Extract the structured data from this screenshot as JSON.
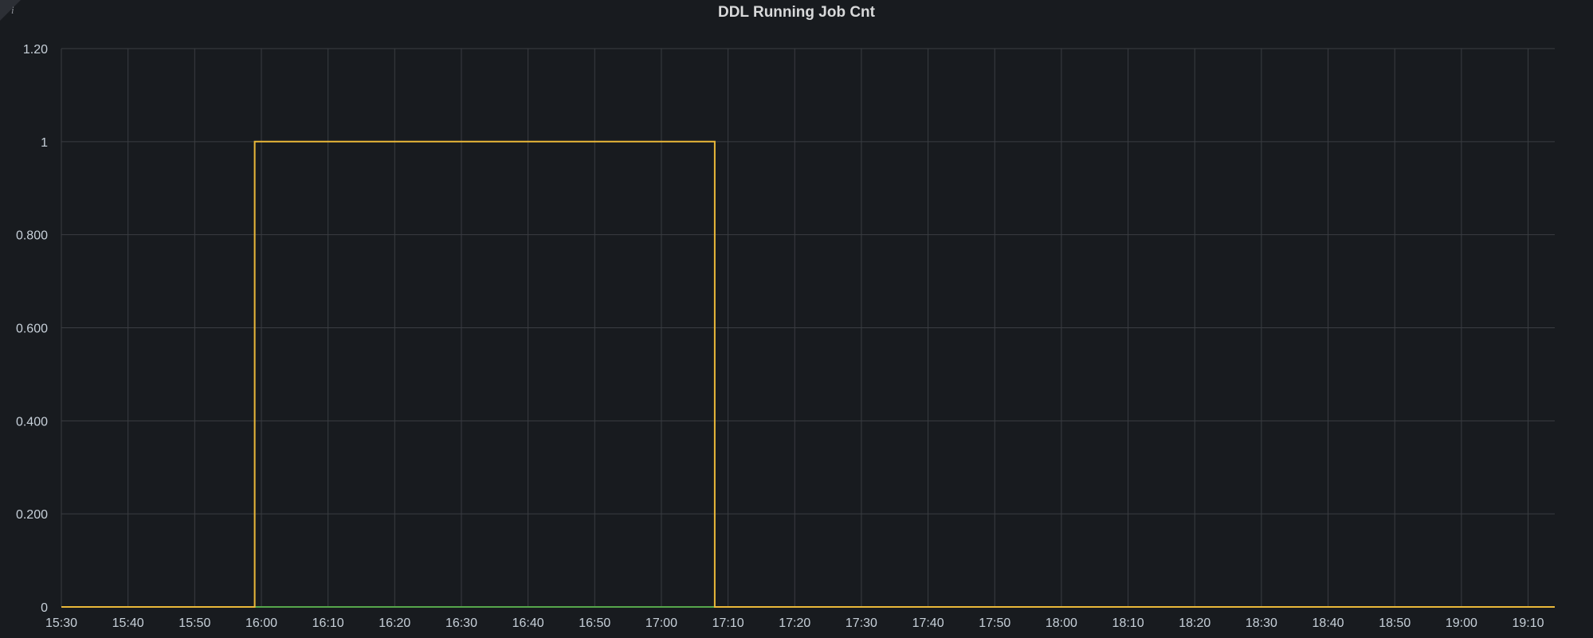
{
  "panel": {
    "title": "DDL Running Job Cnt",
    "info_icon": "info-icon",
    "info_glyph": "i"
  },
  "chart_data": {
    "type": "line",
    "title": "DDL Running Job Cnt",
    "xlabel": "",
    "ylabel": "",
    "x_ticks": [
      "15:30",
      "15:40",
      "15:50",
      "16:00",
      "16:10",
      "16:20",
      "16:30",
      "16:40",
      "16:50",
      "17:00",
      "17:10",
      "17:20",
      "17:30",
      "17:40",
      "17:50",
      "18:00",
      "18:10",
      "18:20",
      "18:30",
      "18:40",
      "18:50",
      "19:00",
      "19:10"
    ],
    "y_ticks": [
      "0",
      "0.200",
      "0.400",
      "0.600",
      "0.800",
      "1",
      "1.20"
    ],
    "xlim": [
      "15:30",
      "19:14"
    ],
    "ylim": [
      0,
      1.2
    ],
    "grid": true,
    "step": true,
    "series": [
      {
        "color": "#eab839",
        "points": [
          [
            "15:30",
            0
          ],
          [
            "15:59",
            0
          ],
          [
            "15:59",
            1
          ],
          [
            "17:08",
            1
          ],
          [
            "17:08",
            0
          ],
          [
            "19:14",
            0
          ]
        ]
      },
      {
        "color": "#56a64b",
        "points": [
          [
            "15:59",
            0
          ],
          [
            "17:08",
            0
          ]
        ]
      }
    ]
  },
  "colors": {
    "background": "#181b1f",
    "grid": "#3a3d42",
    "text": "#c7d0d9",
    "title": "#d8d9da"
  }
}
